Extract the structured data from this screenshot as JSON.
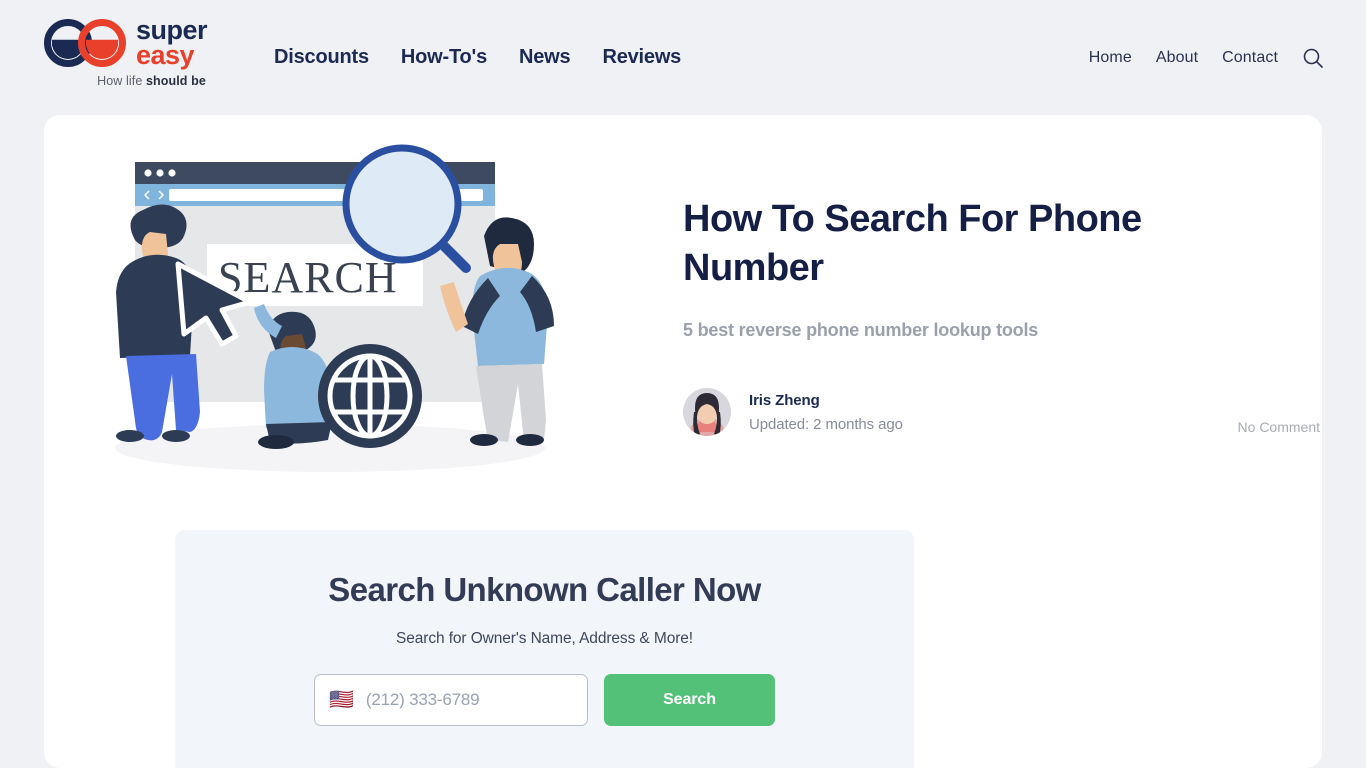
{
  "brand": {
    "name_line1": "super",
    "name_line2": "easy",
    "tagline_prefix": "How life ",
    "tagline_strong": "should be",
    "navy": "#1b2a52",
    "red": "#e8402a"
  },
  "nav": {
    "main": [
      {
        "label": "Discounts"
      },
      {
        "label": "How-To's"
      },
      {
        "label": "News"
      },
      {
        "label": "Reviews"
      }
    ],
    "utility": [
      {
        "label": "Home"
      },
      {
        "label": "About"
      },
      {
        "label": "Contact"
      }
    ],
    "search_icon": "search-icon"
  },
  "article": {
    "title": "How To Search For Phone Number",
    "subtitle": "5 best reverse phone number lookup tools",
    "author": "Iris Zheng",
    "updated": "Updated: 2 months ago",
    "comments": "No Comment"
  },
  "illustration": {
    "browser_search_word": "SEARCH",
    "icons": [
      "magnifier-icon",
      "globe-icon",
      "cursor-arrow-icon"
    ]
  },
  "widget": {
    "title": "Search Unknown Caller Now",
    "subtitle": "Search for Owner's Name, Address & More!",
    "country_flag": "🇺🇸",
    "phone_placeholder": "(212) 333-6789",
    "phone_value": "",
    "button_label": "Search",
    "button_color": "#53c178"
  }
}
